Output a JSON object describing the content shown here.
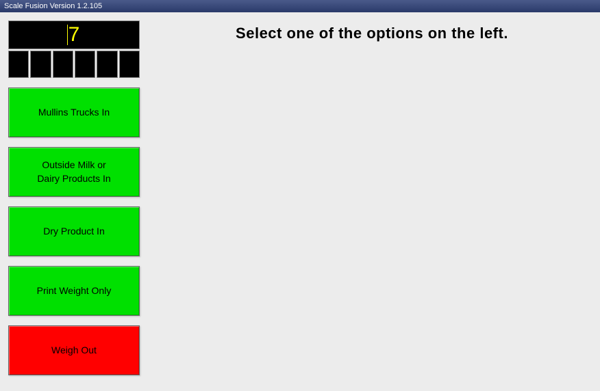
{
  "titleBar": "Scale Fusion Version 1.2.105",
  "display": {
    "value": "7"
  },
  "instruction": "Select one of the options on the left.",
  "buttons": [
    {
      "label": "Mullins Trucks In",
      "color": "green",
      "name": "mullins-trucks-in-button"
    },
    {
      "label": "Outside Milk or\nDairy Products In",
      "color": "green",
      "name": "outside-milk-dairy-button"
    },
    {
      "label": "Dry Product In",
      "color": "green",
      "name": "dry-product-in-button"
    },
    {
      "label": "Print Weight Only",
      "color": "green",
      "name": "print-weight-only-button"
    },
    {
      "label": "Weigh Out",
      "color": "red",
      "name": "weigh-out-button"
    }
  ]
}
